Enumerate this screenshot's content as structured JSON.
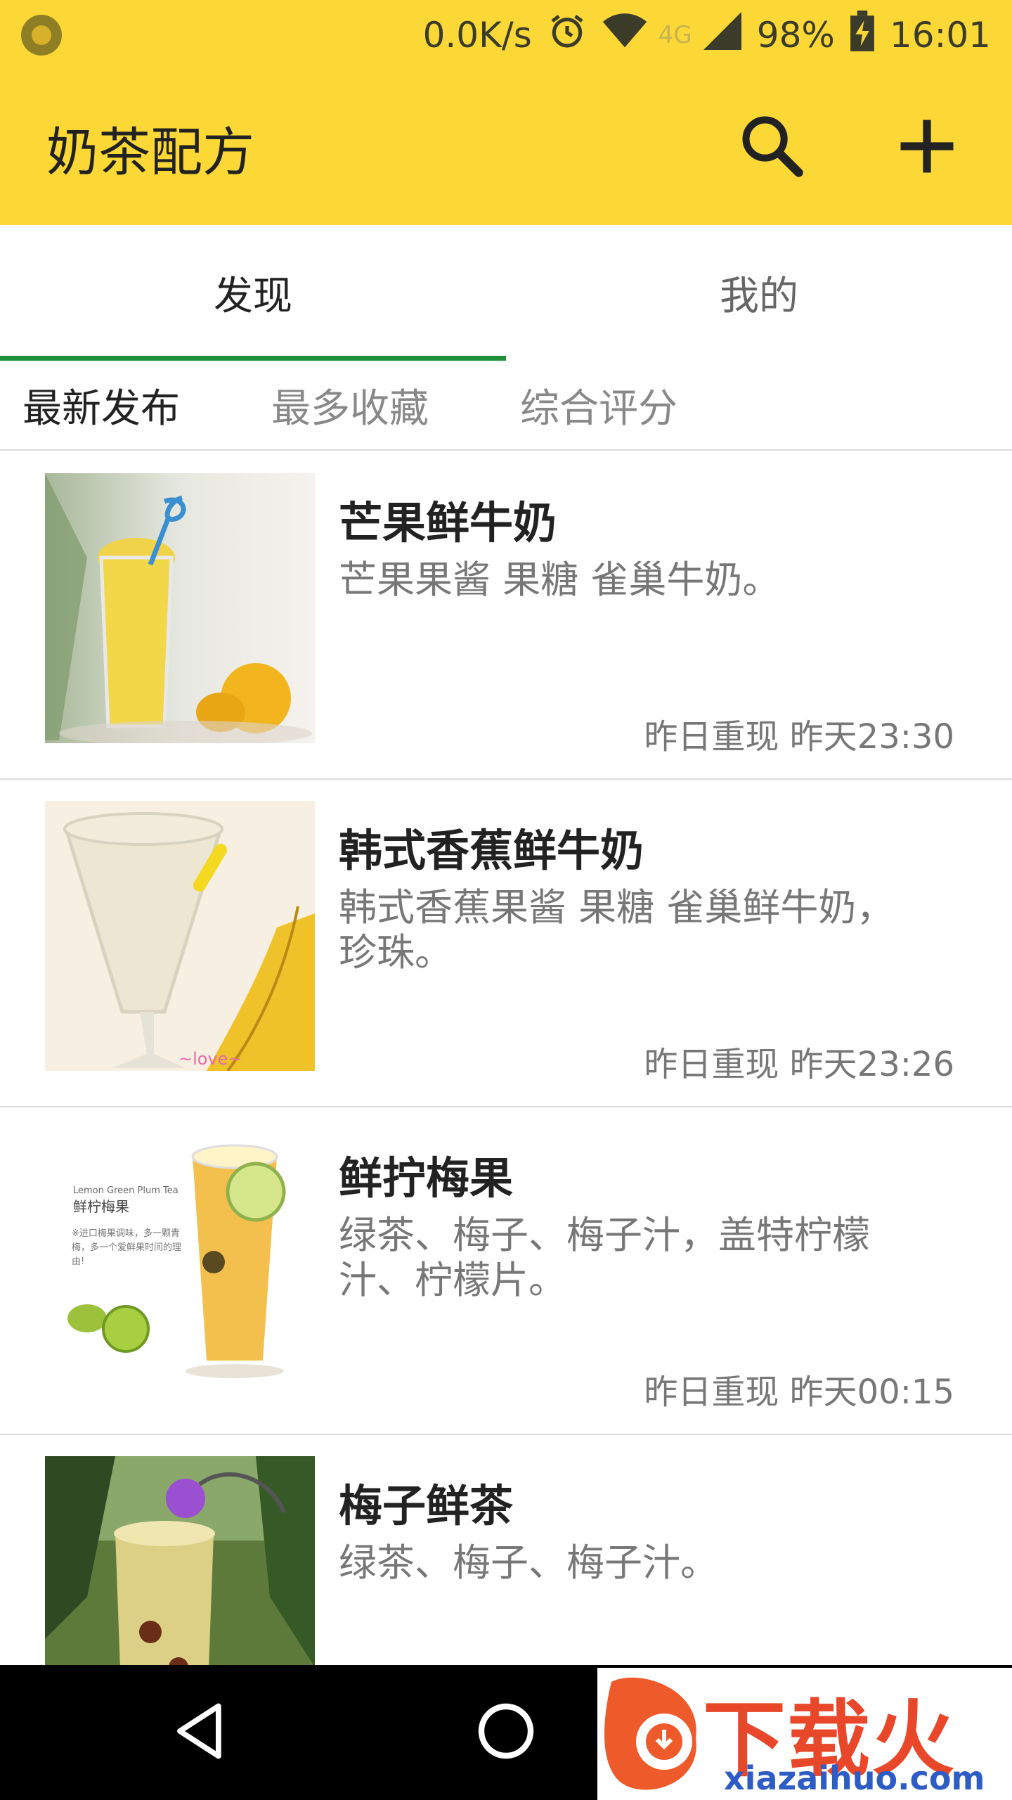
{
  "status_bar": {
    "net_speed": "0.0K/s",
    "network": "4G",
    "battery": "98%",
    "time": "16:01"
  },
  "app_bar": {
    "title": "奶茶配方",
    "search_icon": "search-icon",
    "add_icon": "plus-icon"
  },
  "tabs": [
    {
      "label": "发现",
      "active": true
    },
    {
      "label": "我的",
      "active": false
    }
  ],
  "sub_tabs": [
    {
      "label": "最新发布",
      "active": true
    },
    {
      "label": "最多收藏",
      "active": false
    },
    {
      "label": "综合评分",
      "active": false
    }
  ],
  "recipes": [
    {
      "title": "芒果鲜牛奶",
      "description": "芒果果酱 果糖 雀巢牛奶。",
      "meta": "昨日重现 昨天23:30",
      "thumb": "mango"
    },
    {
      "title": "韩式香蕉鲜牛奶",
      "description": "韩式香蕉果酱 果糖  雀巢鲜牛奶，珍珠。",
      "meta": "昨日重现 昨天23:26",
      "thumb": "banana"
    },
    {
      "title": "鲜拧梅果",
      "description": "绿茶、梅子、梅子汁，盖特柠檬汁、柠檬片。",
      "meta": "昨日重现 昨天00:15",
      "thumb": "plum",
      "thumb_caption_en": "Lemon Green Plum Tea",
      "thumb_caption_cn": "鲜柠梅果",
      "thumb_note": "※进口梅果调味，多一颗青梅，多一个爱鲜果时间的理由!"
    },
    {
      "title": "梅子鲜茶",
      "description": "绿茶、梅子、梅子汁。",
      "meta": "",
      "thumb": "plumtea"
    }
  ],
  "nav_bar": {
    "back_icon": "back-triangle-icon",
    "home_icon": "home-circle-icon"
  },
  "watermark": {
    "text": "下载火",
    "sub": "xiazaihuo.com"
  },
  "colors": {
    "accent_yellow": "#fbd836",
    "tab_indicator": "#1f8f3a"
  }
}
